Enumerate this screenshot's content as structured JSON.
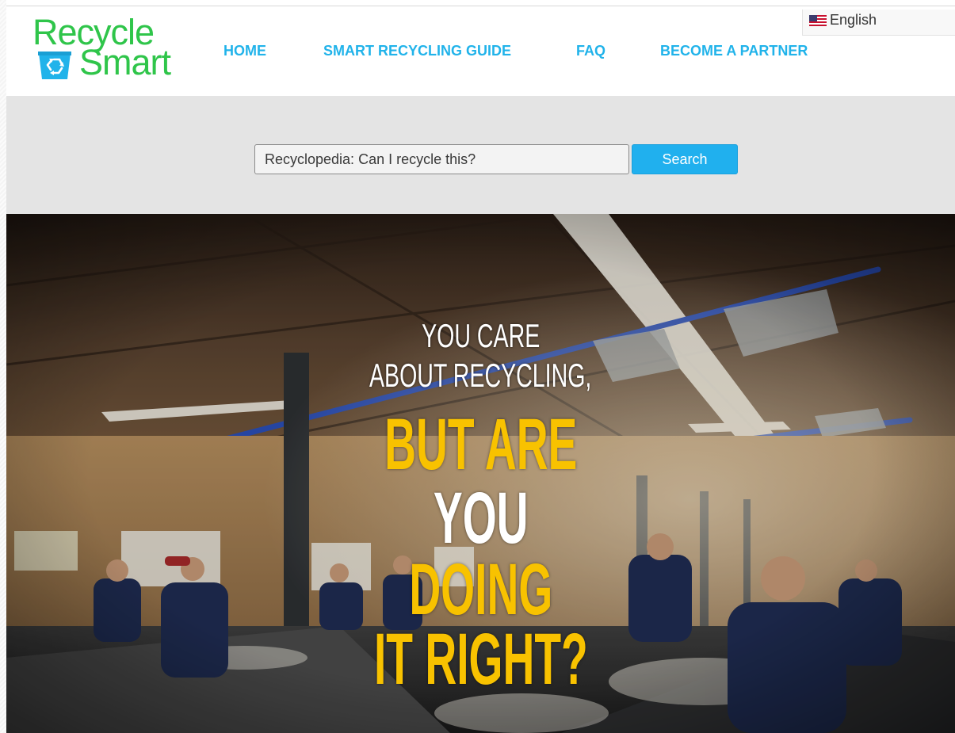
{
  "brand": {
    "logo_line1": "Recycle",
    "logo_line2": "Smart",
    "logo_color": "#2fc54a",
    "logo_icon": "recycling-bin-icon"
  },
  "nav": {
    "items": [
      {
        "label": "HOME"
      },
      {
        "label": "SMART RECYCLING GUIDE"
      },
      {
        "label": "FAQ"
      },
      {
        "label": "BECOME A PARTNER"
      }
    ],
    "color": "#21b3ea"
  },
  "language": {
    "selected": "English",
    "flag_icon": "us-flag-icon"
  },
  "search": {
    "placeholder": "Recyclopedia: Can I recycle this?",
    "value": "",
    "button_label": "Search",
    "button_color": "#20b0ee"
  },
  "hero": {
    "line1": "YOU CARE",
    "line2": "ABOUT RECYCLING,",
    "line3": "BUT ARE",
    "line4": "YOU",
    "line5": "DOING",
    "line6": "IT RIGHT?",
    "accent_color": "#f8c200",
    "image": "recycling-facility-workers-photo"
  }
}
